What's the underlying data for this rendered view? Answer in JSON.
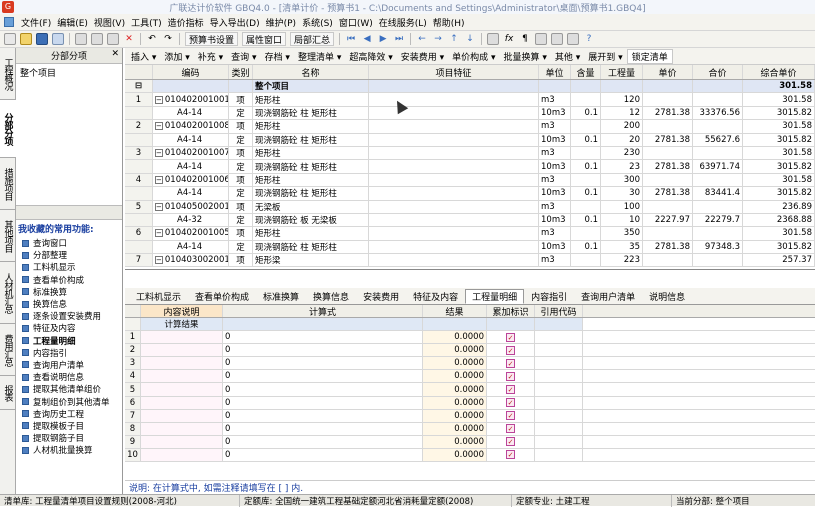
{
  "window": {
    "title": "广联达计价软件 GBQ4.0 - [清单计价 - 预算书1 - C:\\Documents and Settings\\Administrator\\桌面\\预算书1.GBQ4]"
  },
  "menu": [
    "文件(F)",
    "编辑(E)",
    "视图(V)",
    "工具(T)",
    "造价指标",
    "导入导出(D)",
    "维护(P)",
    "系统(S)",
    "窗口(W)",
    "在线服务(L)",
    "帮助(H)"
  ],
  "toolbar": {
    "btn_preview": "预算书设置",
    "btn_attr": "属性窗口",
    "btn_local": "局部汇总"
  },
  "ribbon": [
    "插入 ▾",
    "添加 ▾",
    "补充 ▾",
    "查询 ▾",
    "存档 ▾",
    "整理清单 ▾",
    "超高降效 ▾",
    "安装费用 ▾",
    "单价构成 ▾",
    "批量换算 ▾",
    "其他 ▾",
    "展开到 ▾",
    "锁定清单"
  ],
  "left_tabs": [
    "工程概况",
    "分部分项",
    "措施项目",
    "其他项目",
    "人材机汇总",
    "费用汇总",
    "报表"
  ],
  "left_panel": {
    "title": "分部分项",
    "tree_item": "整个项目",
    "fav_title": "我收藏的常用功能:",
    "fav_items": [
      "查询窗口",
      "分部整理",
      "工料机显示",
      "查看单价构成",
      "标准换算",
      "换算信息",
      "逐条设置安装费用",
      "特征及内容",
      "工程量明细",
      "内容指引",
      "查询用户清单",
      "查看说明信息",
      "提取其他清单组价",
      "复制组价到其他清单",
      "查询历史工程",
      "提取模板子目",
      "提取钢筋子目",
      "人材机批量换算"
    ]
  },
  "grid": {
    "headers": [
      "",
      "编码",
      "类别",
      "名称",
      "项目特征",
      "单位",
      "含量",
      "工程量",
      "单价",
      "合价",
      "综合单价"
    ],
    "group": {
      "name": "整个项目",
      "total": "301.58"
    },
    "rows": [
      {
        "n": "1",
        "code": "010402001001",
        "type": "项",
        "name": "矩形柱",
        "unit": "m3",
        "amt": "",
        "qty": "120",
        "price": "",
        "total": "",
        "cu": "301.58",
        "sub": false
      },
      {
        "n": "",
        "code": "A4-14",
        "type": "定",
        "name": "现浇钢筋砼 柱 矩形柱",
        "unit": "10m3",
        "amt": "0.1",
        "qty": "12",
        "price": "2781.38",
        "total": "33376.56",
        "cu": "3015.82",
        "sub": true
      },
      {
        "n": "2",
        "code": "010402001008",
        "type": "项",
        "name": "矩形柱",
        "unit": "m3",
        "amt": "",
        "qty": "200",
        "price": "",
        "total": "",
        "cu": "301.58",
        "sub": false
      },
      {
        "n": "",
        "code": "A4-14",
        "type": "定",
        "name": "现浇钢筋砼 柱 矩形柱",
        "unit": "10m3",
        "amt": "0.1",
        "qty": "20",
        "price": "2781.38",
        "total": "55627.6",
        "cu": "3015.82",
        "sub": true
      },
      {
        "n": "3",
        "code": "010402001007",
        "type": "项",
        "name": "矩形柱",
        "unit": "m3",
        "amt": "",
        "qty": "230",
        "price": "",
        "total": "",
        "cu": "301.58",
        "sub": false
      },
      {
        "n": "",
        "code": "A4-14",
        "type": "定",
        "name": "现浇钢筋砼 柱 矩形柱",
        "unit": "10m3",
        "amt": "0.1",
        "qty": "23",
        "price": "2781.38",
        "total": "63971.74",
        "cu": "3015.82",
        "sub": true
      },
      {
        "n": "4",
        "code": "010402001006",
        "type": "项",
        "name": "矩形柱",
        "unit": "m3",
        "amt": "",
        "qty": "300",
        "price": "",
        "total": "",
        "cu": "301.58",
        "sub": false
      },
      {
        "n": "",
        "code": "A4-14",
        "type": "定",
        "name": "现浇钢筋砼 柱 矩形柱",
        "unit": "10m3",
        "amt": "0.1",
        "qty": "30",
        "price": "2781.38",
        "total": "83441.4",
        "cu": "3015.82",
        "sub": true
      },
      {
        "n": "5",
        "code": "010405002001",
        "type": "项",
        "name": "无梁板",
        "unit": "m3",
        "amt": "",
        "qty": "100",
        "price": "",
        "total": "",
        "cu": "236.89",
        "sub": false
      },
      {
        "n": "",
        "code": "A4-32",
        "type": "定",
        "name": "现浇钢筋砼 板 无梁板",
        "unit": "10m3",
        "amt": "0.1",
        "qty": "10",
        "price": "2227.97",
        "total": "22279.7",
        "cu": "2368.88",
        "sub": true
      },
      {
        "n": "6",
        "code": "010402001005",
        "type": "项",
        "name": "矩形柱",
        "unit": "m3",
        "amt": "",
        "qty": "350",
        "price": "",
        "total": "",
        "cu": "301.58",
        "sub": false
      },
      {
        "n": "",
        "code": "A4-14",
        "type": "定",
        "name": "现浇钢筋砼 柱 矩形柱",
        "unit": "10m3",
        "amt": "0.1",
        "qty": "35",
        "price": "2781.38",
        "total": "97348.3",
        "cu": "3015.82",
        "sub": true
      },
      {
        "n": "7",
        "code": "010403002001",
        "type": "项",
        "name": "矩形梁",
        "unit": "m3",
        "amt": "",
        "qty": "223",
        "price": "",
        "total": "",
        "cu": "257.37",
        "sub": false
      }
    ]
  },
  "bottom_tabs": [
    "工料机显示",
    "查看单价构成",
    "标准换算",
    "换算信息",
    "安装费用",
    "特征及内容",
    "工程量明细",
    "内容指引",
    "查询用户清单",
    "说明信息"
  ],
  "detail": {
    "headers": [
      "",
      "内容说明",
      "计算式",
      "结果",
      "累加标识",
      "引用代码"
    ],
    "calc_label": "计算结果",
    "rows": [
      {
        "n": "1",
        "expr": "0",
        "res": "0.0000"
      },
      {
        "n": "2",
        "expr": "0",
        "res": "0.0000"
      },
      {
        "n": "3",
        "expr": "0",
        "res": "0.0000"
      },
      {
        "n": "4",
        "expr": "0",
        "res": "0.0000"
      },
      {
        "n": "5",
        "expr": "0",
        "res": "0.0000"
      },
      {
        "n": "6",
        "expr": "0",
        "res": "0.0000"
      },
      {
        "n": "7",
        "expr": "0",
        "res": "0.0000"
      },
      {
        "n": "8",
        "expr": "0",
        "res": "0.0000"
      },
      {
        "n": "9",
        "expr": "0",
        "res": "0.0000"
      },
      {
        "n": "10",
        "expr": "0",
        "res": "0.0000"
      }
    ]
  },
  "note": "说明: 在计算式中, 如需注释请填写在 [ ] 内.",
  "status": [
    "清单库: 工程量清单项目设置规则(2008-河北)",
    "定额库: 全国统一建筑工程基础定额河北省消耗量定额(2008)",
    "定额专业: 土建工程",
    "当前分部: 整个项目"
  ]
}
